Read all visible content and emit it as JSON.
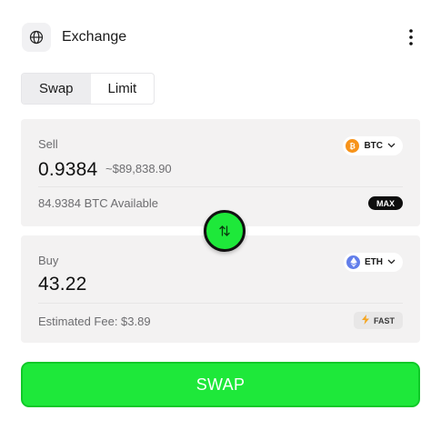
{
  "header": {
    "title": "Exchange",
    "globe_icon": "globe-icon",
    "menu_icon": "more-vertical-icon"
  },
  "tabs": [
    {
      "label": "Swap",
      "active": true
    },
    {
      "label": "Limit",
      "active": false
    }
  ],
  "sell": {
    "label": "Sell",
    "amount": "0.9384",
    "usd_value": "~$89,838.90",
    "token": {
      "symbol": "BTC",
      "icon": "bitcoin-icon",
      "color": "#F7931A"
    },
    "available": "84.9384 BTC Available",
    "max_label": "MAX"
  },
  "buy": {
    "label": "Buy",
    "amount": "43.22",
    "token": {
      "symbol": "ETH",
      "icon": "ethereum-icon",
      "color": "#627EEA"
    },
    "fee": "Estimated Fee: $3.89",
    "speed_label": "FAST"
  },
  "swap_toggle_icon": "swap-arrows-icon",
  "swap_button_label": "SWAP",
  "colors": {
    "accent": "#1EE83A",
    "card_bg": "#F3F2F2",
    "max_bg": "#0E0E0E",
    "fast_icon": "#F5A623"
  }
}
